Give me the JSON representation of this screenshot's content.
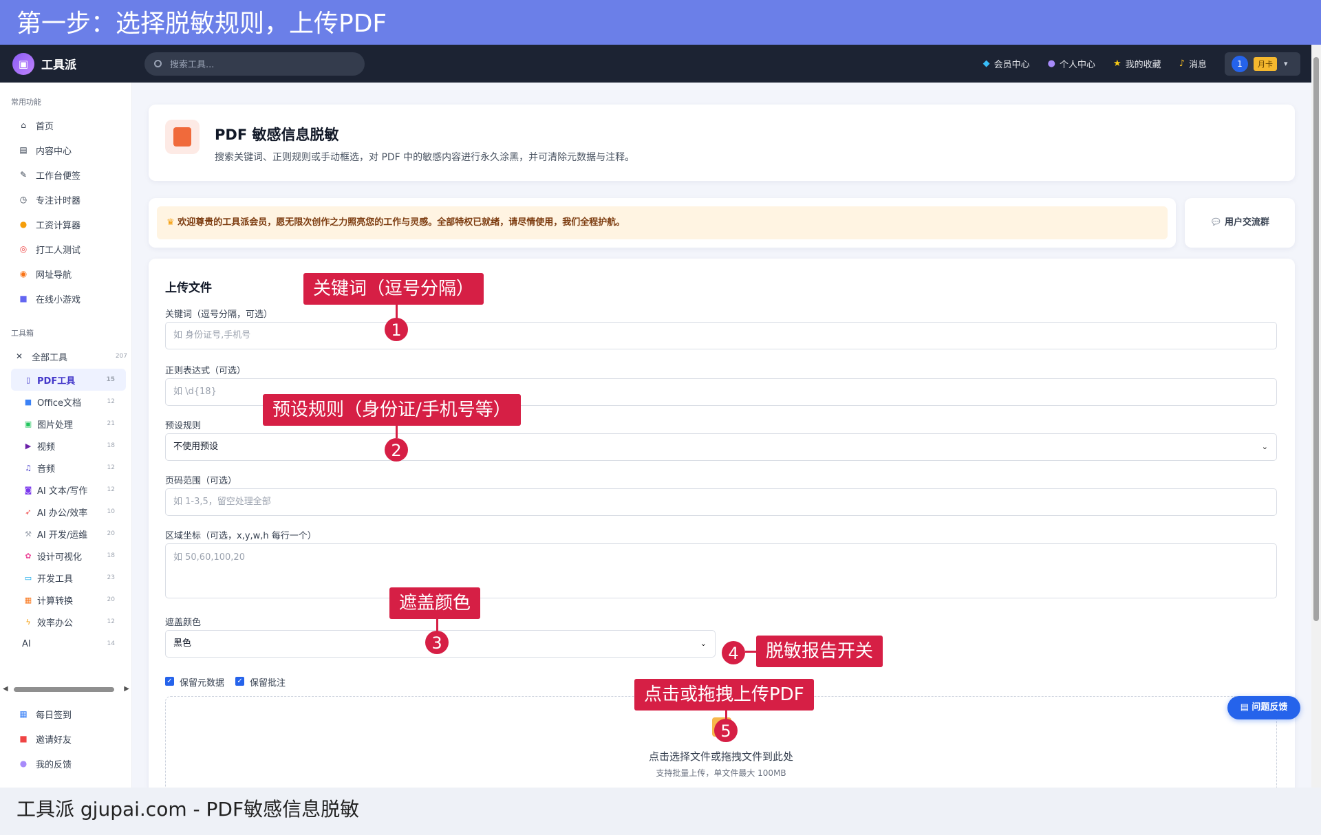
{
  "banner": {
    "top": "第一步：选择脱敏规则，上传PDF",
    "bottom": "工具派 gjupai.com - PDF敏感信息脱敏"
  },
  "topbar": {
    "logo_text": "工具派",
    "search_placeholder": "搜索工具...",
    "nav": [
      {
        "icon": "diamond-icon",
        "label": "会员中心"
      },
      {
        "icon": "person-icon",
        "label": "个人中心"
      },
      {
        "icon": "star-icon",
        "label": "我的收藏"
      },
      {
        "icon": "bell-icon",
        "label": "消息"
      }
    ],
    "user_avatar": "1",
    "user_tag": "月卡"
  },
  "sidebar": {
    "common_title": "常用功能",
    "common": [
      "首页",
      "内容中心",
      "工作台便签",
      "专注计时器",
      "工资计算器",
      "打工人测试",
      "网址导航",
      "在线小游戏"
    ],
    "tools_title": "工具箱",
    "all_tools": {
      "label": "全部工具",
      "count": "207"
    },
    "categories": [
      {
        "label": "PDF工具",
        "count": "15"
      },
      {
        "label": "Office文档",
        "count": "12"
      },
      {
        "label": "图片处理",
        "count": "21"
      },
      {
        "label": "视频",
        "count": "18"
      },
      {
        "label": "音频",
        "count": "12"
      },
      {
        "label": "AI 文本/写作",
        "count": "12"
      },
      {
        "label": "AI 办公/效率",
        "count": "10"
      },
      {
        "label": "AI 开发/运维",
        "count": "20"
      },
      {
        "label": "设计可视化",
        "count": "18"
      },
      {
        "label": "开发工具",
        "count": "23"
      },
      {
        "label": "计算转换",
        "count": "20"
      },
      {
        "label": "效率办公",
        "count": "12"
      },
      {
        "label": "AI",
        "count": "14"
      }
    ],
    "bottom": [
      "每日签到",
      "邀请好友",
      "我的反馈"
    ]
  },
  "hero": {
    "title": "PDF 敏感信息脱敏",
    "desc": "搜索关键词、正则规则或手动框选，对 PDF 中的敏感内容进行永久涂黑，并可清除元数据与注释。"
  },
  "welcome": "欢迎尊贵的工具派会员，愿无限次创作之力照亮您的工作与灵感。全部特权已就绪，请尽情使用，我们全程护航。",
  "group_button": "用户交流群",
  "form": {
    "title": "上传文件",
    "keywords_label": "关键词（逗号分隔，可选）",
    "keywords_placeholder": "如 身份证号,手机号",
    "regex_label": "正则表达式（可选）",
    "regex_placeholder": "如 \\d{18}",
    "preset_label": "预设规则",
    "preset_value": "不使用预设",
    "pages_label": "页码范围（可选）",
    "pages_placeholder": "如 1-3,5，留空处理全部",
    "area_label": "区域坐标（可选，x,y,w,h 每行一个）",
    "area_placeholder": "如 50,60,100,20",
    "color_label": "遮盖颜色",
    "color_value": "黑色",
    "keep_meta": "保留元数据",
    "keep_annot": "保留批注",
    "drop_title": "点击选择文件或拖拽文件到此处",
    "drop_sub": "支持批量上传，单文件最大 100MB"
  },
  "feedback_button": "问题反馈",
  "callouts": {
    "c1": "关键词（逗号分隔）",
    "c2": "预设规则（身份证/手机号等）",
    "c3": "遮盖颜色",
    "c4": "脱敏报告开关",
    "c5": "点击或拖拽上传PDF"
  },
  "markers": [
    "1",
    "2",
    "3",
    "4",
    "5"
  ],
  "colors": {
    "accent": "#2563eb",
    "banner": "#6b7fe8",
    "callout": "#d61f45",
    "topbar": "#1c2333"
  }
}
